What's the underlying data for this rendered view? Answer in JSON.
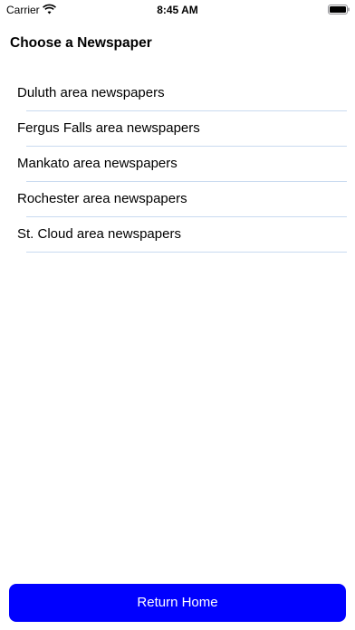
{
  "status_bar": {
    "carrier": "Carrier",
    "time": "8:45 AM",
    "wifi_icon": "wifi-icon",
    "battery_icon": "battery-icon",
    "battery_level": 1.0
  },
  "header": {
    "title": "Choose a Newspaper"
  },
  "newspapers": {
    "items": [
      {
        "label": "Duluth area newspapers"
      },
      {
        "label": "Fergus Falls area newspapers"
      },
      {
        "label": "Mankato area newspapers"
      },
      {
        "label": "Rochester area newspapers"
      },
      {
        "label": "St. Cloud area newspapers"
      }
    ]
  },
  "footer": {
    "return_label": "Return Home"
  },
  "colors": {
    "button_background": "#0000ff",
    "button_text": "#ffffff",
    "separator": "#c9daf0"
  }
}
